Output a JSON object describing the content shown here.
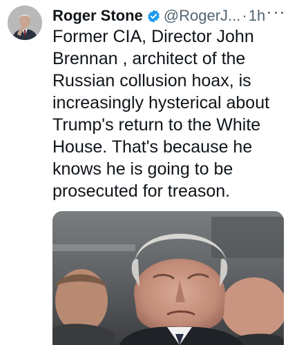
{
  "tweet": {
    "author_name": "Roger Stone",
    "handle": "@RogerJ...",
    "separator": "·",
    "time": "1h",
    "verified_color": "#1d9bf0",
    "body_lines": [
      "Former CIA, Director John",
      "Brennan , architect of the",
      "Russian collusion hoax, is",
      "increasingly hysterical about",
      "Trump's return to the White",
      "House. That's because he",
      "knows he is going to be",
      "prosecuted for treason."
    ]
  },
  "icons": {
    "verified": "verified-badge-icon",
    "more": "more-options-icon"
  }
}
